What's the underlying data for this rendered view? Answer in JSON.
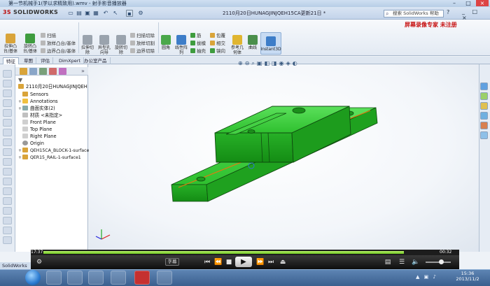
{
  "player_title": "第一节机械手1(学以求精致用).wmv - 射手影音播放器",
  "app": {
    "logo_prefix": "3S",
    "logo_text": "SOLIDWORKS",
    "document_title": "2110月20日HUNAGJINJQEH15CA更新21日 *",
    "search_placeholder": "搜索 SolidWorks 帮助",
    "help": "?",
    "window_controls": "_ □ ×",
    "watermark": "屏幕录像专家 未注册"
  },
  "ribbon": {
    "large_tools": [
      {
        "label": "拉伸凸\n台/基体",
        "icon": "extrude-icon",
        "color": "#d9a43a"
      },
      {
        "label": "旋转凸\n台/基体",
        "icon": "revolve-icon",
        "color": "#3e9c3e"
      },
      {
        "label": "拉伸切\n除",
        "icon": "cut-extrude-icon",
        "color": "#9aa3ad"
      },
      {
        "label": "异型孔\n向导",
        "icon": "hole-wizard-icon",
        "color": "#9aa3ad"
      },
      {
        "label": "旋转切\n除",
        "icon": "cut-revolve-icon",
        "color": "#9aa3ad"
      },
      {
        "label": "圆角",
        "icon": "fillet-icon",
        "color": "#4aa84a"
      },
      {
        "label": "线性阵\n列",
        "icon": "linear-pattern-icon",
        "color": "#3d7dc8"
      },
      {
        "label": "参考几\n何体",
        "icon": "reference-geometry-icon",
        "color": "#e0b530"
      },
      {
        "label": "曲线",
        "icon": "curves-icon",
        "color": "#4b8f4b"
      },
      {
        "label": "Instant3D",
        "icon": "instant3d-icon",
        "color": "#3d7dc8"
      }
    ],
    "small_tools": [
      {
        "label": "扫描",
        "icon": "sweep-icon",
        "color": "#b8b8b8"
      },
      {
        "label": "放样凸台/基体",
        "icon": "loft-icon",
        "color": "#b8b8b8"
      },
      {
        "label": "边界凸台/基体",
        "icon": "boundary-icon",
        "color": "#b8b8b8"
      },
      {
        "label": "扫描切除",
        "icon": "swept-cut-icon",
        "color": "#b8b8b8"
      },
      {
        "label": "放样切割",
        "icon": "lofted-cut-icon",
        "color": "#b8b8b8"
      },
      {
        "label": "边界切除",
        "icon": "boundary-cut-icon",
        "color": "#b8b8b8"
      },
      {
        "label": "筋",
        "icon": "rib-icon",
        "color": "#3e9c3e"
      },
      {
        "label": "拔模",
        "icon": "draft-icon",
        "color": "#3e9c3e"
      },
      {
        "label": "抽壳",
        "icon": "shell-icon",
        "color": "#3e9c3e"
      },
      {
        "label": "包覆",
        "icon": "wrap-icon",
        "color": "#d9a43a"
      },
      {
        "label": "相交",
        "icon": "intersect-icon",
        "color": "#d9a43a"
      },
      {
        "label": "镜向",
        "icon": "mirror-icon",
        "color": "#3e9c3e"
      }
    ]
  },
  "tabs": [
    "特征",
    "草图",
    "评估",
    "DimXpert",
    "办公室产品"
  ],
  "tree": {
    "root": "2110月20日HUNAGJINJQEH",
    "items": [
      {
        "label": "Sensors",
        "icon": "sensors-icon",
        "color": "#d9a43a",
        "expand": ""
      },
      {
        "label": "Annotations",
        "icon": "annotations-icon",
        "color": "#f0c040",
        "expand": "+"
      },
      {
        "label": "曲面实体(2)",
        "icon": "surface-bodies-icon",
        "color": "#8aa",
        "expand": "+"
      },
      {
        "label": "材质 <未指定>",
        "icon": "material-icon",
        "color": "#c0c0c0",
        "expand": ""
      },
      {
        "label": "Front Plane",
        "icon": "plane-icon",
        "color": "#cfcfcf",
        "expand": ""
      },
      {
        "label": "Top Plane",
        "icon": "plane-icon",
        "color": "#cfcfcf",
        "expand": ""
      },
      {
        "label": "Right Plane",
        "icon": "plane-icon",
        "color": "#cfcfcf",
        "expand": ""
      },
      {
        "label": "Origin",
        "icon": "origin-icon",
        "color": "#999",
        "expand": ""
      },
      {
        "label": "QEH15CA_BLOCK-1-surface",
        "icon": "feature-icon",
        "color": "#d9a43a",
        "expand": "+"
      },
      {
        "label": "QER15_RAIL-1-surface1",
        "icon": "feature-icon",
        "color": "#d9a43a",
        "expand": "+"
      }
    ]
  },
  "model": {
    "body_color": "#31c831",
    "edge_color": "#0f4a0f",
    "accent_line": "#e07a10"
  },
  "player": {
    "time_left": "17:37",
    "time_right": "00:32",
    "progress": 0.92,
    "subtitle_button": "字幕",
    "volume": 0.6
  },
  "taskbar": {
    "sw_label": "SolidWorks P",
    "time": "15:36",
    "date": "2013/11/2"
  }
}
